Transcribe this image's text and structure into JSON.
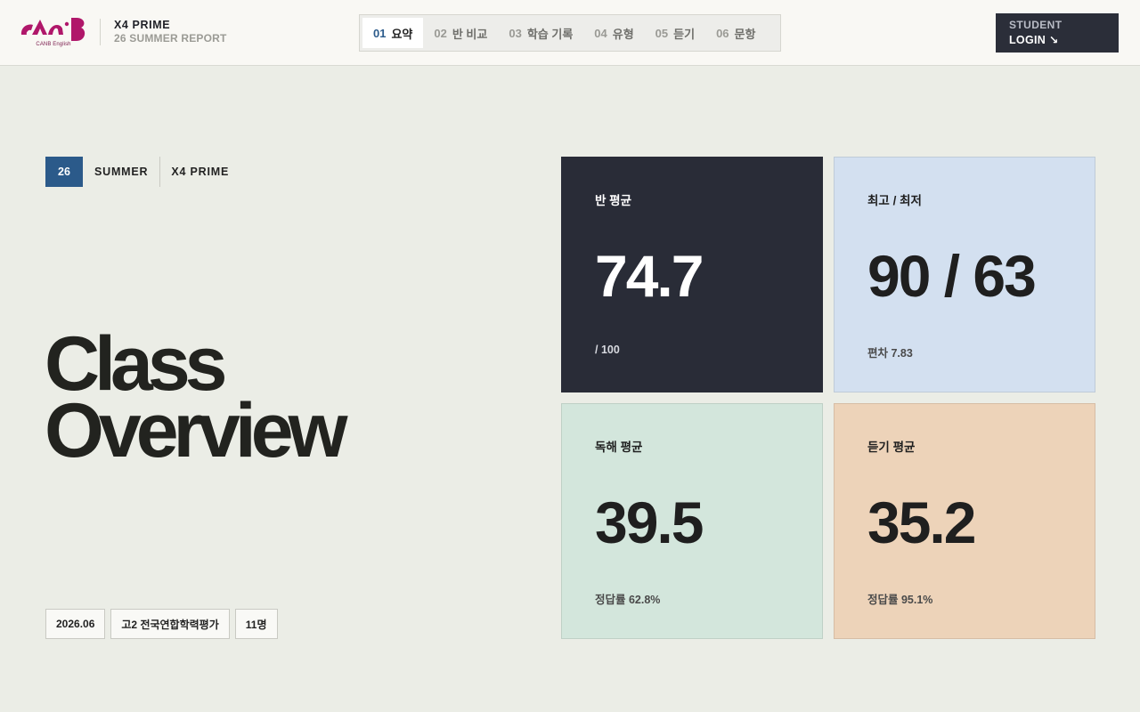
{
  "brand": {
    "logo_text": "CANB",
    "logo_sub": "CANB English",
    "title": "X4 PRIME",
    "subtitle": "26 SUMMER REPORT",
    "logo_color": "#b0176a"
  },
  "nav": {
    "tabs": [
      {
        "num": "01",
        "label": "요약",
        "active": true
      },
      {
        "num": "02",
        "label": "반 비교",
        "active": false
      },
      {
        "num": "03",
        "label": "학습 기록",
        "active": false
      },
      {
        "num": "04",
        "label": "유형",
        "active": false
      },
      {
        "num": "05",
        "label": "듣기",
        "active": false
      },
      {
        "num": "06",
        "label": "문항",
        "active": false
      }
    ]
  },
  "login": {
    "line1": "STUDENT",
    "line2": "LOGIN ↘"
  },
  "tags": {
    "year": "26",
    "season": "SUMMER",
    "class": "X4 PRIME"
  },
  "hero": {
    "line1": "Class",
    "line2": "Overview"
  },
  "chips": [
    "2026.06",
    "고2 전국연합학력평가",
    "11명"
  ],
  "cards": {
    "avg": {
      "label": "반 평균",
      "value": "74.7",
      "foot": "/ 100",
      "bg": "#292c37"
    },
    "hl": {
      "label": "최고 / 최저",
      "value": "90 / 63",
      "foot": "편차 7.83",
      "bg": "#d3e0f0"
    },
    "read": {
      "label": "독해 평균",
      "value": "39.5",
      "foot": "정답률 62.8%",
      "bg": "#d3e6dc"
    },
    "lis": {
      "label": "듣기 평균",
      "value": "35.2",
      "foot": "정답률 95.1%",
      "bg": "#edd3b9"
    }
  },
  "colors": {
    "accent_blue": "#2b5a8a",
    "dark": "#292c37",
    "page_bg": "#ebede6"
  }
}
